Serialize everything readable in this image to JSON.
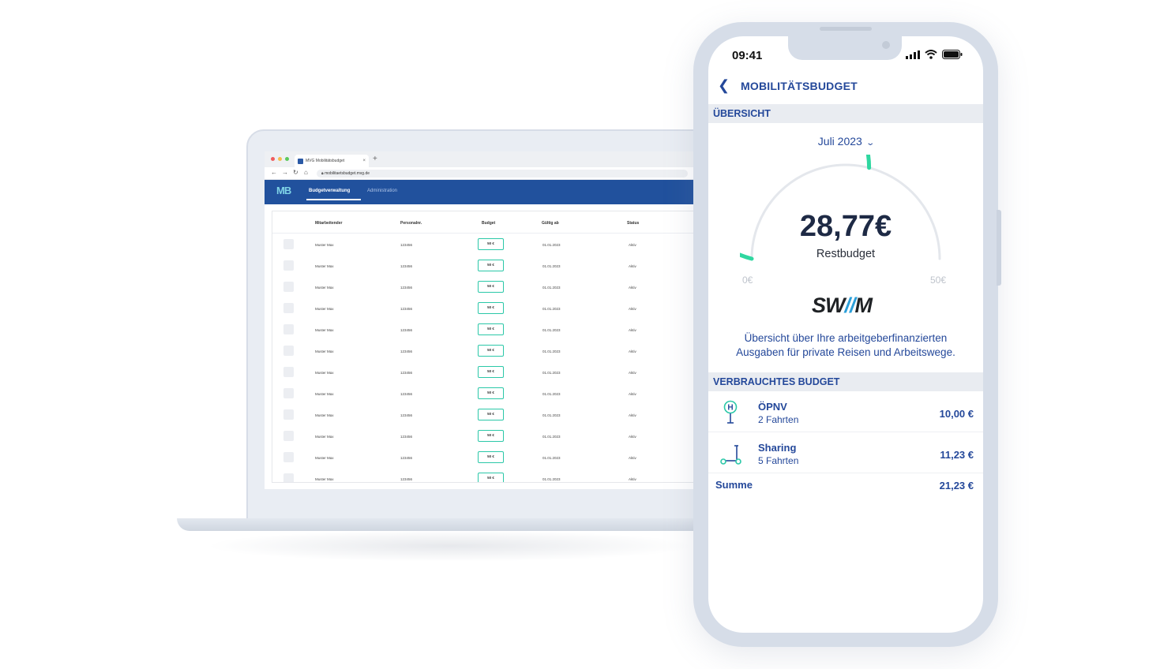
{
  "browser": {
    "tab_title": "MVG Mobilitätsbudget",
    "tab_close": "×",
    "new_tab": "+",
    "url": "mobilitaetsbudget.mvg.de"
  },
  "web_app": {
    "logo": "MB",
    "tabs": [
      {
        "label": "Budgetverwaltung",
        "active": true
      },
      {
        "label": "Administration",
        "active": false
      }
    ],
    "table": {
      "columns": [
        "Mitarbeitender",
        "Personalnr.",
        "Budget",
        "Gültig ab",
        "Status"
      ],
      "rows": [
        {
          "name": "Muster Max",
          "number": "123456",
          "budget": "50 €",
          "valid_from": "01.01.2023",
          "status": "Aktiv"
        },
        {
          "name": "Muster Max",
          "number": "123456",
          "budget": "50 €",
          "valid_from": "01.01.2023",
          "status": "Aktiv"
        },
        {
          "name": "Muster Max",
          "number": "123456",
          "budget": "50 €",
          "valid_from": "01.01.2023",
          "status": "Aktiv"
        },
        {
          "name": "Muster Max",
          "number": "123456",
          "budget": "50 €",
          "valid_from": "01.01.2023",
          "status": "Aktiv"
        },
        {
          "name": "Muster Max",
          "number": "123456",
          "budget": "50 €",
          "valid_from": "01.01.2023",
          "status": "Aktiv"
        },
        {
          "name": "Muster Max",
          "number": "123456",
          "budget": "50 €",
          "valid_from": "01.01.2023",
          "status": "Aktiv"
        },
        {
          "name": "Muster Max",
          "number": "123456",
          "budget": "50 €",
          "valid_from": "01.01.2023",
          "status": "Aktiv"
        },
        {
          "name": "Muster Max",
          "number": "123456",
          "budget": "50 €",
          "valid_from": "01.01.2023",
          "status": "Aktiv"
        },
        {
          "name": "Muster Max",
          "number": "123456",
          "budget": "50 €",
          "valid_from": "01.01.2023",
          "status": "Aktiv"
        },
        {
          "name": "Muster Max",
          "number": "123456",
          "budget": "50 €",
          "valid_from": "01.01.2023",
          "status": "Aktiv"
        },
        {
          "name": "Muster Max",
          "number": "123456",
          "budget": "50 €",
          "valid_from": "01.01.2023",
          "status": "Aktiv"
        },
        {
          "name": "Muster Max",
          "number": "123456",
          "budget": "50 €",
          "valid_from": "01.01.2023",
          "status": "Aktiv"
        }
      ]
    },
    "colors": {
      "header": "#21519d",
      "budget_border": "#2bc8a8"
    }
  },
  "mobile": {
    "status_time": "09:41",
    "nav_title": "MOBILITÄTSBUDGET",
    "overview_heading": "ÜBERSICHT",
    "month": "Juli 2023",
    "gauge": {
      "value": "28,77€",
      "label": "Restbudget",
      "min": "0€",
      "max": "50€",
      "fraction_used": 0.4246
    },
    "brand": {
      "left": "SW",
      "slash": "//",
      "right": "M"
    },
    "description": "Übersicht über Ihre arbeitgeberfinanzierten Ausgaben für private Reisen und Arbeitswege.",
    "spent_heading": "VERBRAUCHTES BUDGET",
    "items": [
      {
        "name": "ÖPNV",
        "trips": "2 Fahrten",
        "amount": "10,00 €",
        "icon": "bus-stop-icon"
      },
      {
        "name": "Sharing",
        "trips": "5 Fahrten",
        "amount": "11,23 €",
        "icon": "scooter-icon"
      }
    ],
    "sum_label": "Summe",
    "sum_amount": "21,23 €",
    "colors": {
      "primary": "#24489a",
      "gauge": "#2fd7a0",
      "track": "#e4e7ec"
    }
  }
}
